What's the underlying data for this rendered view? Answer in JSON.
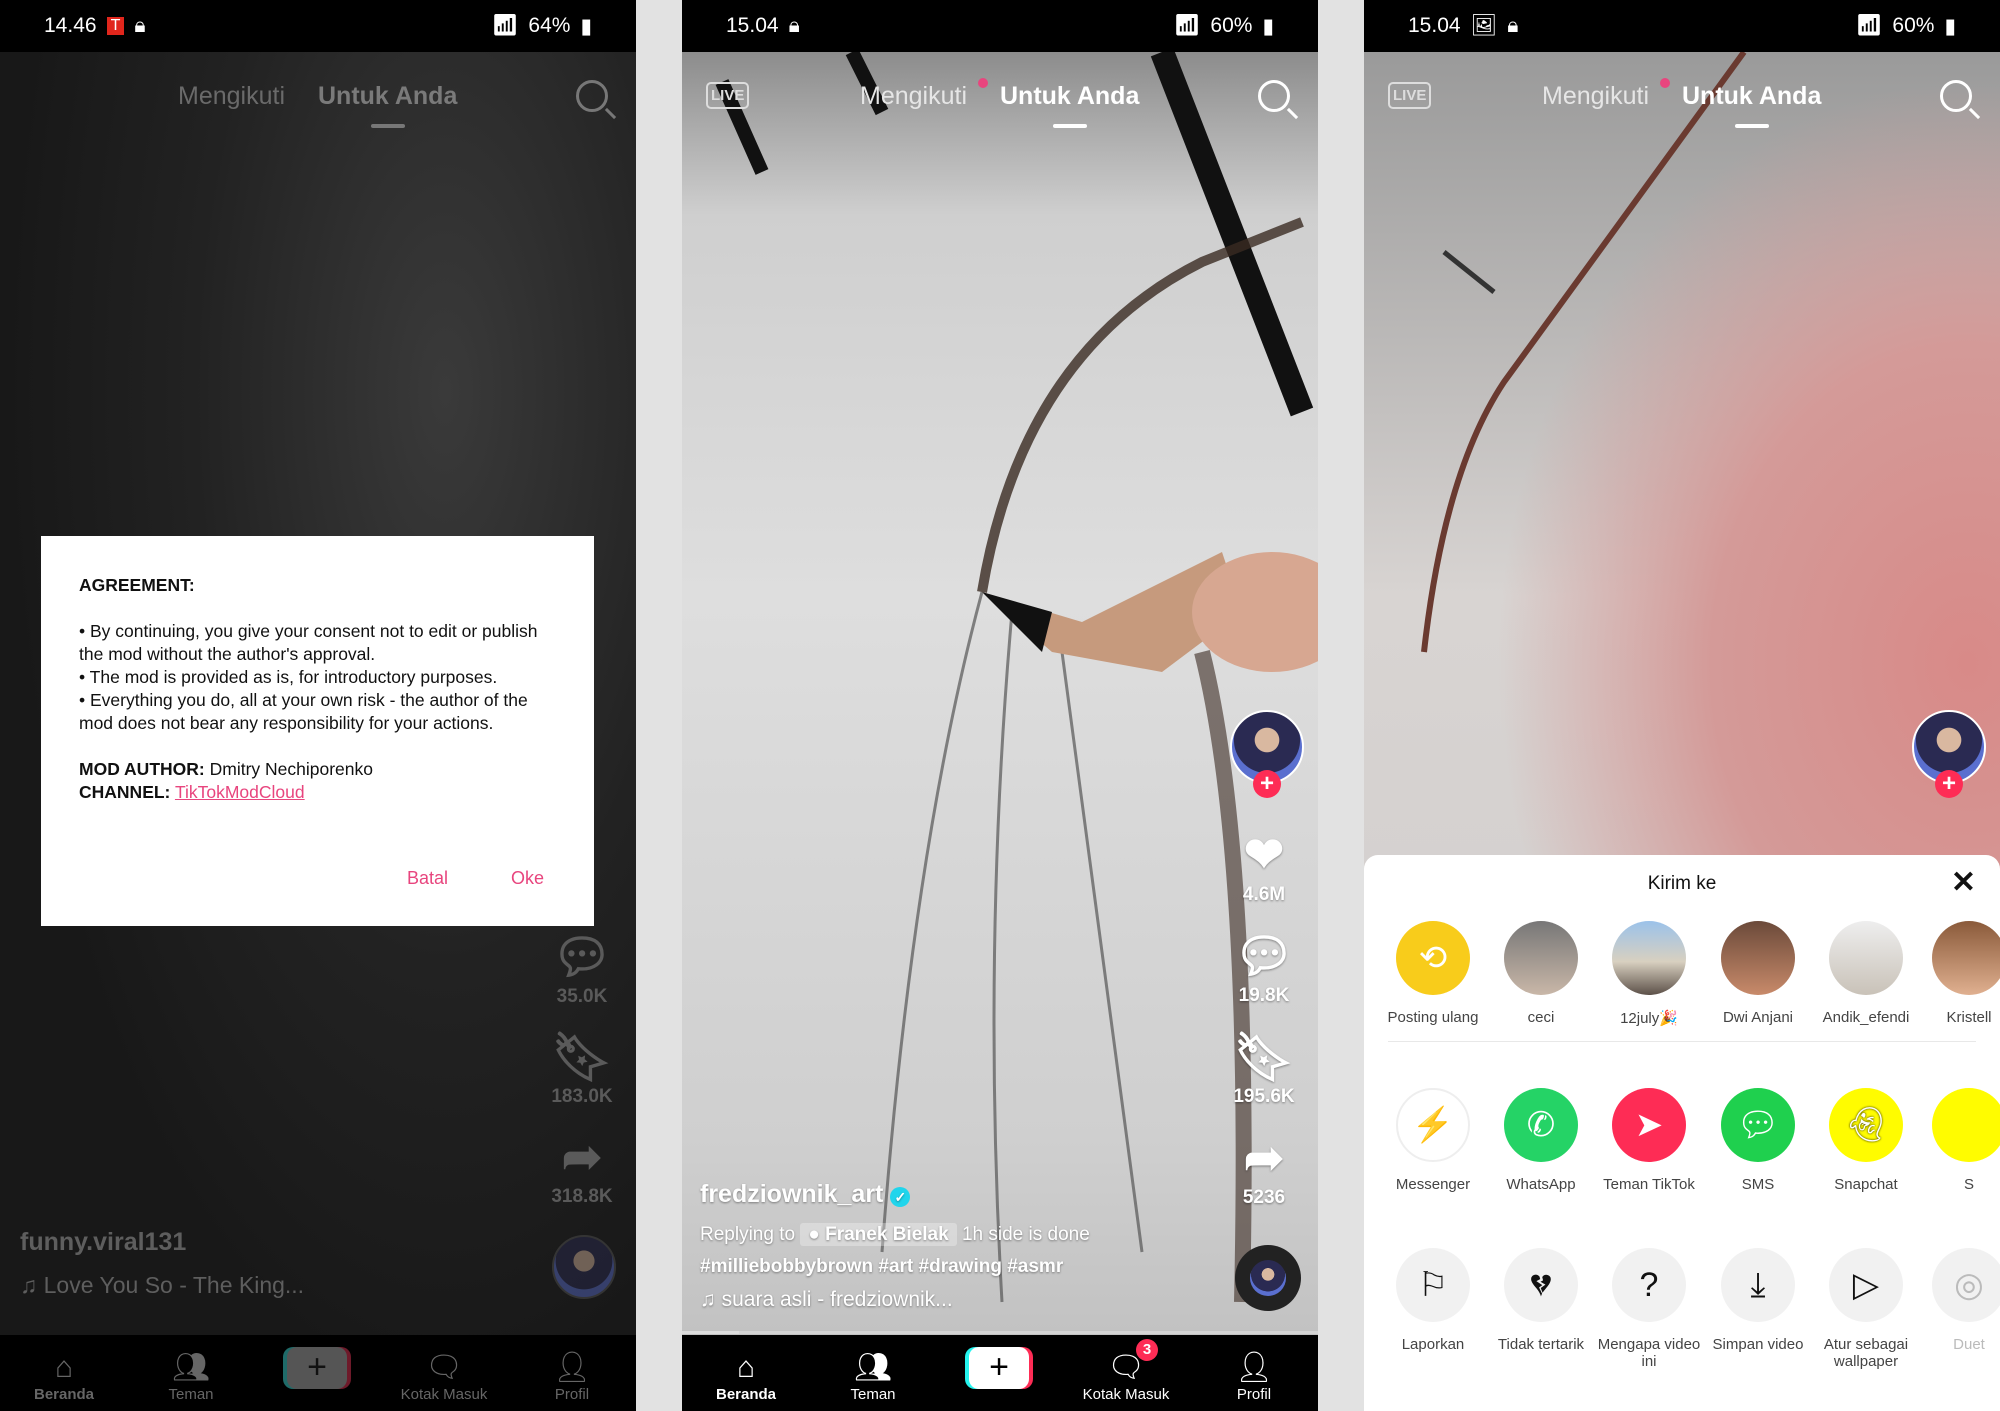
{
  "panel1": {
    "status": {
      "time": "14.46",
      "battery": "64%"
    },
    "tabs": {
      "following": "Mengikuti",
      "for_you": "Untuk Anda"
    },
    "side": {
      "comments": "35.0K",
      "saves": "183.0K",
      "shares": "318.8K"
    },
    "video": {
      "username": "funny.viral131",
      "sound": "Love You So - The King..."
    },
    "dialog": {
      "title": "AGREEMENT:",
      "bullet1": "• By continuing, you give your consent not to edit or publish the mod without the author's approval.",
      "bullet2": "• The mod is provided as is, for introductory purposes.",
      "bullet3": "• Everything you do, all at your own risk - the author of the mod does not bear any responsibility for your actions.",
      "author_label": "MOD AUTHOR:",
      "author": "Dmitry Nechiporenko",
      "channel_label": "CHANNEL:",
      "channel": "TikTokModCloud",
      "cancel": "Batal",
      "ok": "Oke"
    },
    "nav": {
      "home": "Beranda",
      "friends": "Teman",
      "inbox": "Kotak Masuk",
      "profile": "Profil"
    }
  },
  "panel2": {
    "status": {
      "time": "15.04",
      "battery": "60%"
    },
    "live": "LIVE",
    "tabs": {
      "following": "Mengikuti",
      "for_you": "Untuk Anda"
    },
    "side": {
      "likes": "4.6M",
      "comments": "19.8K",
      "saves": "195.6K",
      "shares": "5236"
    },
    "video": {
      "username": "fredziownik_art",
      "replying": "Replying to",
      "reply_user": "Franek Bielak",
      "caption": "1h side is done",
      "hashtags": "#milliebobbybrown #art #drawing #asmr",
      "sound": "suara asli - fredziownik..."
    },
    "nav": {
      "home": "Beranda",
      "friends": "Teman",
      "inbox": "Kotak Masuk",
      "inbox_badge": "3",
      "profile": "Profil"
    }
  },
  "panel3": {
    "status": {
      "time": "15.04",
      "battery": "60%"
    },
    "live": "LIVE",
    "tabs": {
      "following": "Mengikuti",
      "for_you": "Untuk Anda"
    },
    "sheet": {
      "title": "Kirim ke",
      "contacts": [
        {
          "label": "Posting ulang"
        },
        {
          "label": "ceci"
        },
        {
          "label": "12july🎉"
        },
        {
          "label": "Dwi Anjani"
        },
        {
          "label": "Andik_efendi"
        },
        {
          "label": "Kristell"
        }
      ],
      "apps": [
        {
          "label": "Messenger",
          "color": "#ffffff"
        },
        {
          "label": "WhatsApp",
          "color": "#25d366"
        },
        {
          "label": "Teman TikTok",
          "color": "#fe2c55"
        },
        {
          "label": "SMS",
          "color": "#1fd04e"
        },
        {
          "label": "Snapchat",
          "color": "#fffc00"
        },
        {
          "label": "S",
          "color": "#fffc00"
        }
      ],
      "actions": [
        {
          "label": "Laporkan"
        },
        {
          "label": "Tidak tertarik"
        },
        {
          "label": "Mengapa video ini"
        },
        {
          "label": "Simpan video"
        },
        {
          "label": "Atur sebagai wallpaper"
        },
        {
          "label": "Duet"
        }
      ]
    }
  }
}
